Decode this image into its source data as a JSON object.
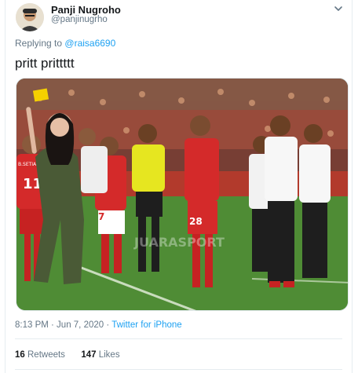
{
  "author": {
    "display_name": "Panji Nugroho",
    "handle": "@panjinugrho"
  },
  "menu_icon": "chevron-down-icon",
  "reply": {
    "prefix": "Replying to",
    "to_handle": "@raisa6690"
  },
  "tweet": {
    "text": "pritt prittttt"
  },
  "media": {
    "watermark": "JUARASPORT",
    "jersey_numbers": [
      "11",
      "7",
      "28"
    ],
    "jersey_name": "B.SETIAWAN"
  },
  "meta": {
    "timestamp": "8:13 PM · Jun 7, 2020",
    "separator": "·",
    "source": "Twitter for iPhone"
  },
  "stats": {
    "retweets_count": "16",
    "retweets_label": "Retweets",
    "likes_count": "147",
    "likes_label": "Likes"
  },
  "colors": {
    "accent": "#1da1f2",
    "muted": "#657786",
    "text": "#14171a"
  }
}
